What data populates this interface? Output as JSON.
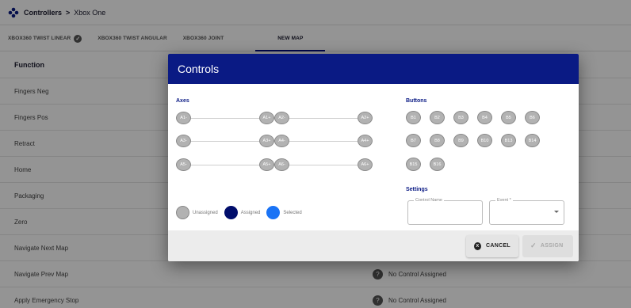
{
  "breadcrumb": {
    "root": "Controllers",
    "separator": ">",
    "current": "Xbox One"
  },
  "tabs": [
    {
      "label": "XBOX360 TWIST LINEAR"
    },
    {
      "label": "XBOX360 TWIST ANGULAR"
    },
    {
      "label": "XBOX360 JOINT"
    },
    {
      "label": "NEW MAP"
    }
  ],
  "table": {
    "header": "Function",
    "rows": [
      {
        "fn": "Fingers Neg"
      },
      {
        "fn": "Fingers Pos"
      },
      {
        "fn": "Retract"
      },
      {
        "fn": "Home"
      },
      {
        "fn": "Packaging"
      },
      {
        "fn": "Zero"
      },
      {
        "fn": "Navigate Next Map"
      },
      {
        "fn": "Navigate Prev Map",
        "ctl": "No Control Assigned",
        "q": "?"
      },
      {
        "fn": "Apply Emergency Stop",
        "ctl": "No Control Assigned",
        "q": "?"
      }
    ]
  },
  "dialog": {
    "title": "Controls",
    "axes_title": "Axes",
    "axes": [
      [
        "A1-",
        "A1+",
        "A2-",
        "A2+"
      ],
      [
        "A3-",
        "A3+",
        "A4-",
        "A4+"
      ],
      [
        "A5-",
        "A5+",
        "A6-",
        "A6+"
      ]
    ],
    "buttons_title": "Buttons",
    "buttons": [
      "B1",
      "B2",
      "B3",
      "B4",
      "B5",
      "B6",
      "B7",
      "B8",
      "B9",
      "B10",
      "B13",
      "B14",
      "B15",
      "B16"
    ],
    "legend": {
      "unassigned": "Unassigned",
      "assigned": "Assigned",
      "selected": "Selected"
    },
    "settings_title": "Settings",
    "control_name_label": "Control Name",
    "event_label": "Event *",
    "cancel": "CANCEL",
    "cancel_icon": "x",
    "assign": "ASSIGN",
    "assign_icon": "✓"
  },
  "colors": {
    "header": "#0a1a84",
    "assigned": "#000d6b",
    "selected": "#1a73f5",
    "unassigned": "#b2b2b2"
  }
}
